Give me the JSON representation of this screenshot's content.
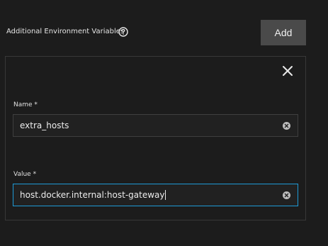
{
  "section": {
    "title": "Additional Environment Variables",
    "help_icon": "help-circle-icon",
    "add_label": "Add"
  },
  "env_var": {
    "close_icon": "close-icon",
    "name": {
      "label": "Name *",
      "value": "extra_hosts",
      "clear_icon": "clear-icon"
    },
    "value": {
      "label": "Value *",
      "value": "host.docker.internal:host-gateway",
      "clear_icon": "clear-icon"
    }
  },
  "colors": {
    "background": "#1c1c1c",
    "button": "#4a4a4a",
    "focus_border": "#1e9bd7",
    "card_border": "#383838"
  }
}
